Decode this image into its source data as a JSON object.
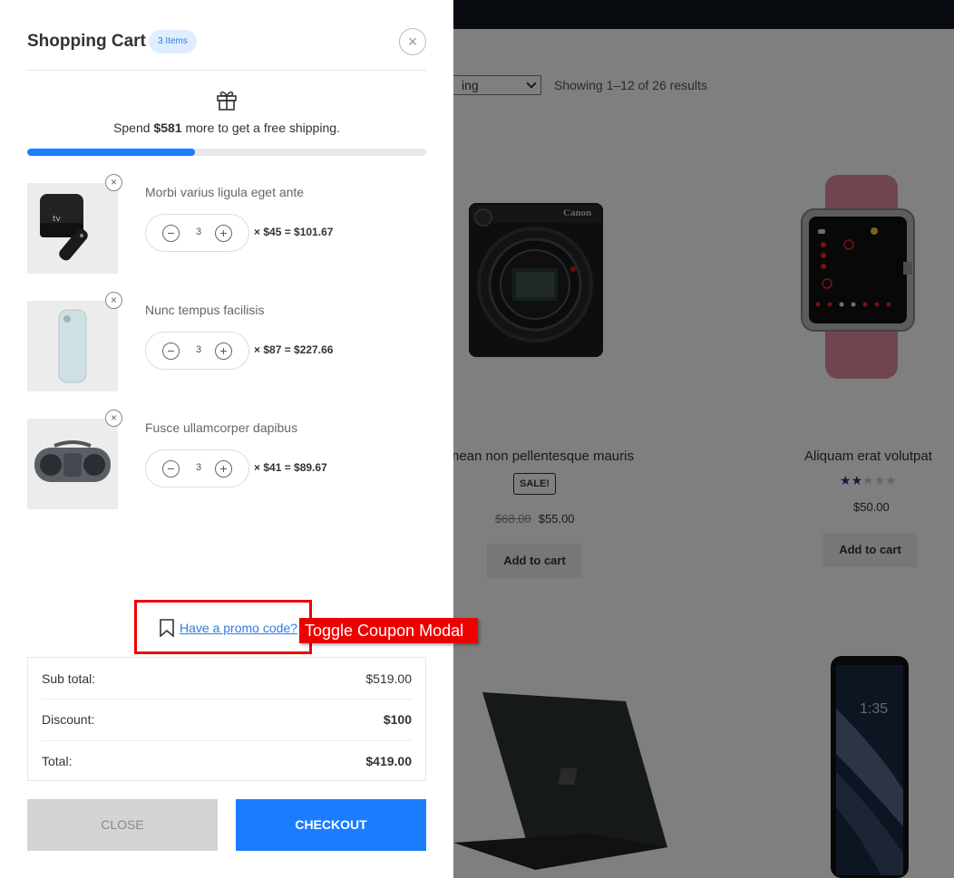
{
  "shop": {
    "sort_label": "ing",
    "results_text": "Showing 1–12 of 26 results",
    "products": [
      {
        "title": "nean non pellentesque mauris",
        "sale_badge": "SALE!",
        "old_price": "$68.00",
        "price": "$55.00",
        "button": "Add to cart",
        "brand_text": "Canon"
      },
      {
        "title": "Aliquam erat volutpat",
        "rating": 2,
        "rating_max": 5,
        "price": "$50.00",
        "button": "Add to cart"
      }
    ]
  },
  "cart": {
    "title": "Shopping Cart",
    "count_badge": "3 Items",
    "close_icon": "×",
    "shipping": {
      "prefix": "Spend ",
      "amount": "$581",
      "suffix": " more to get a free shipping.",
      "progress": 0.42
    },
    "items": [
      {
        "name": "Morbi varius ligula eget ante",
        "qty": "3",
        "calc": "× $45 = $101.67",
        "image": "apple-tv"
      },
      {
        "name": "Nunc tempus facilisis",
        "qty": "3",
        "calc": "× $87 = $227.66",
        "image": "phone-case"
      },
      {
        "name": "Fusce ullamcorper dapibus",
        "qty": "3",
        "calc": "× $41 = $89.67",
        "image": "boombox-speaker"
      }
    ],
    "promo_link": "Have a promo code?",
    "annotation_label": "Toggle Coupon Modal",
    "totals": {
      "subtotal_label": "Sub total:",
      "subtotal_value": "$519.00",
      "discount_label": "Discount:",
      "discount_value": "$100",
      "total_label": "Total:",
      "total_value": "$419.00"
    },
    "close_button": "CLOSE",
    "checkout_button": "CHECKOUT"
  },
  "colors": {
    "accent": "#1a7dff",
    "highlight": "#ee0000",
    "badge_bg": "#dfeeff"
  }
}
